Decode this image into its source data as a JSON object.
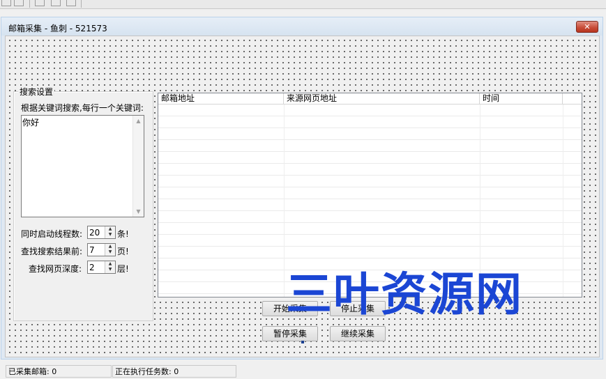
{
  "window": {
    "title": "邮箱采集 - 鱼刺 - 521573",
    "close_symbol": "✕"
  },
  "search_group": {
    "title": "搜索设置",
    "description": "根据关键词搜索,每行一个关键词:",
    "keywords_value": "你好"
  },
  "settings": [
    {
      "label": "同时启动线程数:",
      "value": "20",
      "unit": "条!"
    },
    {
      "label": "查找搜索结果前:",
      "value": "7",
      "unit": "页!"
    },
    {
      "label": "查找网页深度:",
      "value": "2",
      "unit": "层!"
    }
  ],
  "results_table": {
    "columns": [
      "邮箱地址",
      "来源网页地址",
      "时间"
    ],
    "rows": []
  },
  "buttons": {
    "start": "开始采集",
    "stop": "停止采集",
    "pause": "暂停采集",
    "resume": "继续采集"
  },
  "status": {
    "collected": "已采集邮箱: 0",
    "running_tasks": "正在执行任务数: 0"
  },
  "watermark": "三叶资源网"
}
